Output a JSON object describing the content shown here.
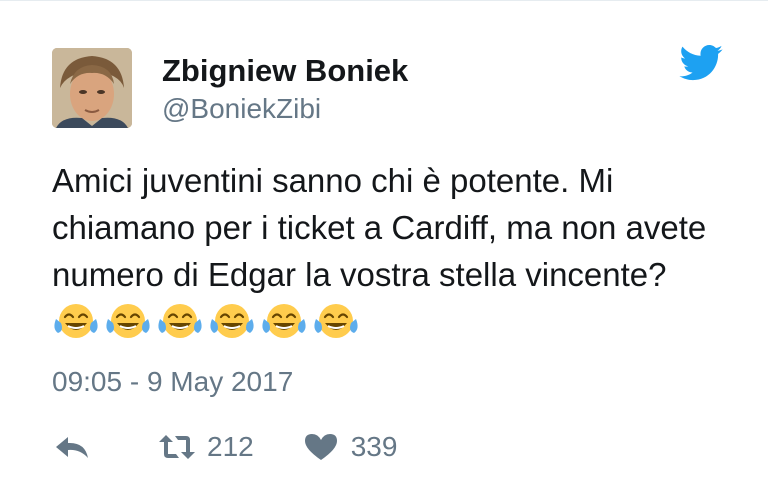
{
  "tweet": {
    "display_name": "Zbigniew Boniek",
    "handle": "@BoniekZibi",
    "text": "Amici juventini sanno chi è potente. Mi chiamano per i ticket a Cardiff, ma non avete numero di Edgar la vostra stella vincente?",
    "emoji": [
      "face-with-tears-of-joy-icon",
      "face-with-tears-of-joy-icon",
      "face-with-tears-of-joy-icon",
      "face-with-tears-of-joy-icon",
      "face-with-tears-of-joy-icon",
      "face-with-tears-of-joy-icon"
    ],
    "timestamp": "09:05 - 9 May 2017",
    "retweets": "212",
    "likes": "339"
  },
  "colors": {
    "twitter_blue": "#1da1f2",
    "text": "#14171a",
    "muted": "#657786",
    "emoji_yellow": "#ffcc4d",
    "emoji_tears": "#5dadec"
  },
  "icons": [
    "twitter-bird-icon",
    "reply-icon",
    "retweet-icon",
    "heart-icon"
  ]
}
